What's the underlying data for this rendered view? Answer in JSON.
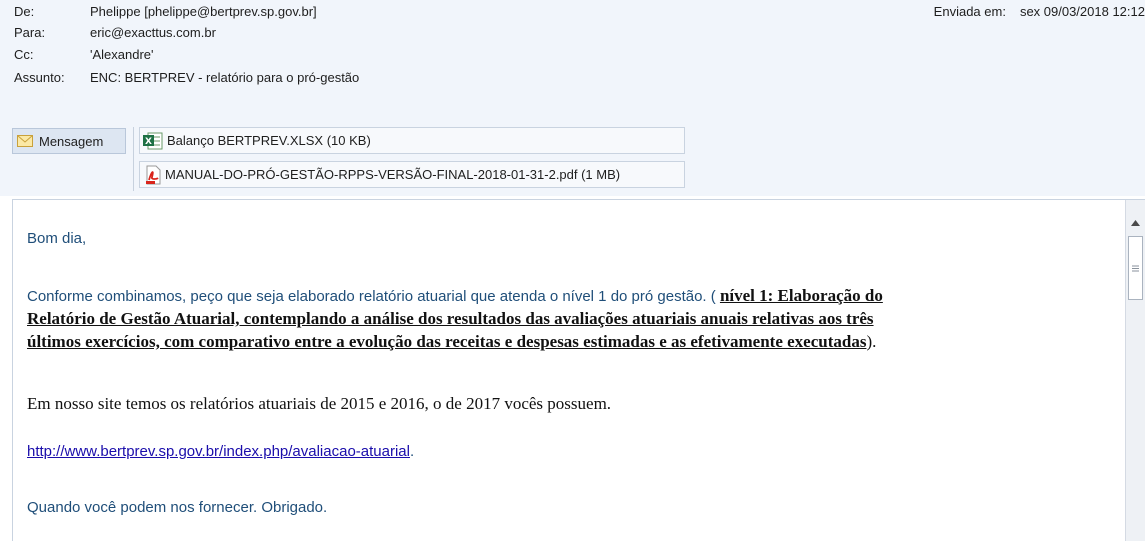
{
  "email": {
    "from_label": "De:",
    "from_value": "Phelippe [phelippe@bertprev.sp.gov.br]",
    "to_label": "Para:",
    "to_value": "eric@exacttus.com.br",
    "cc_label": "Cc:",
    "cc_value": "'Alexandre'",
    "subject_label": "Assunto:",
    "subject_value": "ENC: BERTPREV - relatório para o pró-gestão",
    "sent_label": "Enviada em:",
    "sent_value": "sex 09/03/2018 12:12"
  },
  "attachments": {
    "message_label": "Mensagem",
    "files": [
      {
        "name": "Balanço BERTPREV.XLSX (10 KB)",
        "icon": "excel-file-icon"
      },
      {
        "name": "MANUAL-DO-PRÓ-GESTÃO-RPPS-VERSÃO-FINAL-2018-01-31-2.pdf (1 MB)",
        "icon": "pdf-file-icon"
      }
    ]
  },
  "body": {
    "greeting": "Bom dia,",
    "p1_intro": "Conforme combinamos, peço que seja elaborado relatório atuarial que atenda o nível 1 do pró gestão. ( ",
    "p1_bold_line1": "nível 1: Elaboração do",
    "p1_bold_line2": "Relatório de Gestão Atuarial, contemplando a análise dos resultados das avaliações atuariais anuais relativas aos três",
    "p1_bold_line3": "últimos exercícios, com comparativo entre a evolução das receitas e despesas estimadas e as efetivamente executadas",
    "p1_end": ").",
    "p2": "Em nosso site temos os relatórios atuariais de 2015 e 2016, o de 2017 vocês possuem.",
    "link": "http://www.bertprev.sp.gov.br/index.php/avaliacao-atuarial",
    "link_end": ".",
    "p4": "Quando você podem nos fornecer. Obrigado."
  }
}
